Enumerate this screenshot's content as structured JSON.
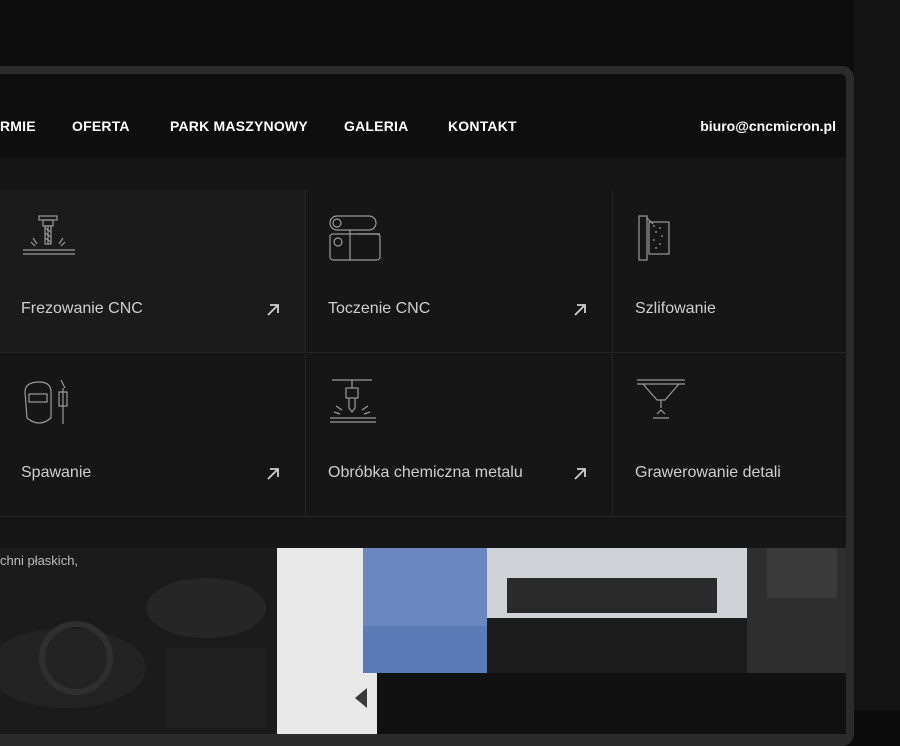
{
  "nav": {
    "items": [
      {
        "label": "RMIE"
      },
      {
        "label": "OFERTA"
      },
      {
        "label": "PARK MASZYNOWY"
      },
      {
        "label": "GALERIA"
      },
      {
        "label": "KONTAKT"
      }
    ],
    "email": "biuro@cncmicron.pl"
  },
  "services": [
    {
      "label": "Frezowanie CNC",
      "icon": "milling-icon",
      "arrow": "arrow-up-right-icon"
    },
    {
      "label": "Toczenie CNC",
      "icon": "lathe-icon",
      "arrow": "arrow-up-right-icon"
    },
    {
      "label": "Szlifowanie",
      "icon": "grinding-icon"
    },
    {
      "label": "Spawanie",
      "icon": "welding-mask-icon",
      "arrow": "arrow-up-right-icon"
    },
    {
      "label": "Obróbka chemiczna metalu",
      "icon": "chemical-treatment-icon",
      "arrow": "arrow-up-right-icon"
    },
    {
      "label": "Grawerowanie detali",
      "icon": "engraving-icon"
    }
  ],
  "hero": {
    "text": "chni płaskich,"
  },
  "colors": {
    "background": "#0e0e0e",
    "menu": "#161616",
    "icon_stroke": "#9a9a9a",
    "machine_blue": "#5b7bb6"
  }
}
